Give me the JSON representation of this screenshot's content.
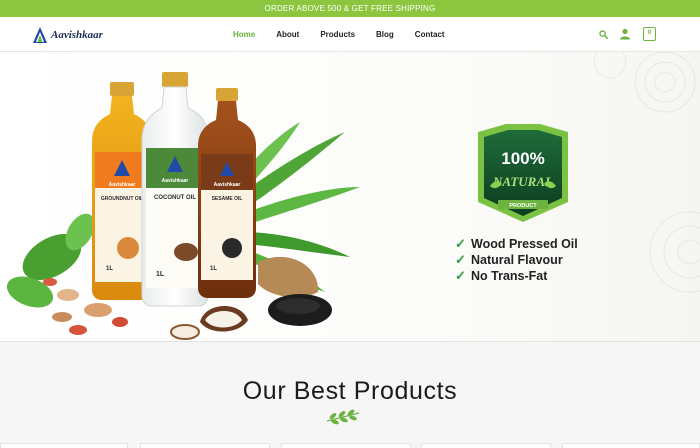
{
  "topbar": {
    "text": "ORDER ABOVE 500 & GET FREE SHIPPING"
  },
  "brand": {
    "name": "Aavishkaar",
    "color": "#1f2d55",
    "accent": "#6db33f"
  },
  "nav": {
    "items": [
      {
        "label": "Home",
        "active": true
      },
      {
        "label": "About"
      },
      {
        "label": "Products"
      },
      {
        "label": "Blog"
      },
      {
        "label": "Contact"
      }
    ]
  },
  "header_icons": {
    "search": "search-icon",
    "account": "user-icon",
    "cart_count": "0"
  },
  "hero": {
    "badge_top": "100%",
    "badge_main": "NATURAL",
    "badge_sub": "PRODUCT",
    "benefits": [
      "Wood Pressed Oil",
      "Natural Flavour",
      "No Trans-Fat"
    ],
    "bottles": [
      {
        "name": "GROUNDNUT OIL",
        "brand": "Aavishkaar",
        "size": "1L"
      },
      {
        "name": "COCONUT OIL",
        "brand": "Aavishkaar",
        "size": "1L"
      },
      {
        "name": "SESAME OIL",
        "brand": "Aavishkaar",
        "size": "1L"
      }
    ]
  },
  "section": {
    "title": "Our Best Products"
  },
  "colors": {
    "topbar": "#8cc63f",
    "green": "#6db33f",
    "badge_dark": "#0f4d2a"
  }
}
